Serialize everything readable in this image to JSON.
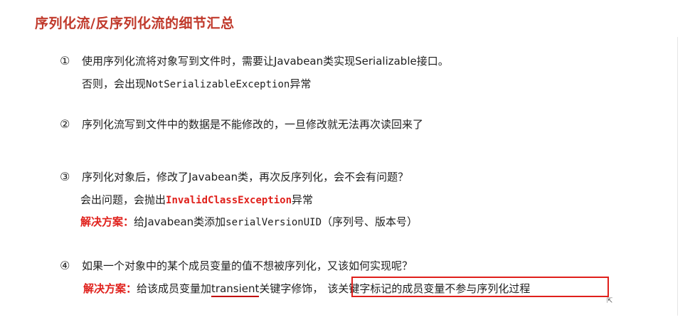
{
  "title": "序列化流/反序列化流的细节汇总",
  "items": [
    {
      "number": "①",
      "line1": "使用序列化流将对象写到文件时，需要让Javabean类实现Serializable接口。",
      "line2_prefix": "否则，会出现",
      "line2_code": "NotSerializableException",
      "line2_suffix": "异常"
    },
    {
      "number": "②",
      "line1": "序列化流写到文件中的数据是不能修改的，一旦修改就无法再次读回来了"
    },
    {
      "number": "③",
      "line1": "序列化对象后，修改了Javabean类，再次反序列化，会不会有问题？",
      "line2_prefix": "会出问题，会抛出",
      "line2_code": "InvalidClassException",
      "line2_suffix": "异常",
      "line3_label": "解决方案：",
      "line3_prefix": "给Javabean类添加",
      "line3_code": "serialVersionUID",
      "line3_suffix": "（序列号、版本号）"
    },
    {
      "number": "④",
      "line1": "如果一个对象中的某个成员变量的值不想被序列化，又该如何实现呢？",
      "line2_label": "解决方案：",
      "line2_prefix": "给该成员变量加",
      "line2_keyword": "transient",
      "line2_middle": "关键字修饰，",
      "line2_boxed": "该关键字标记的成员变量不参与序列化过程"
    }
  ],
  "colors": {
    "title": "#c0392b",
    "emphasis": "#e0201b",
    "underline": "#c00000",
    "box": "#e0201b"
  }
}
